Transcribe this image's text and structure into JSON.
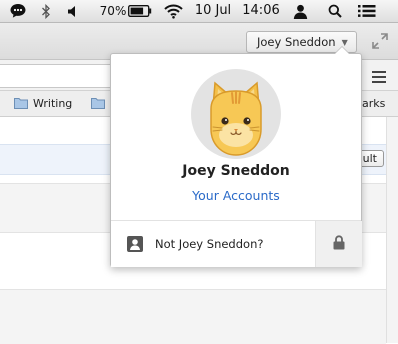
{
  "menubar": {
    "battery_percent": "70%",
    "date": "10 Jul",
    "time": "14:06",
    "icons": [
      "chat-bubble-icon",
      "bluetooth-icon",
      "volume-icon",
      "battery-icon",
      "wifi-icon",
      "user-icon",
      "search-icon",
      "list-icon"
    ]
  },
  "browser": {
    "profile_button_label": "Joey Sneddon",
    "bookmarks": [
      {
        "label": "Writing"
      },
      {
        "label": ""
      },
      {
        "label": "arks"
      }
    ],
    "partial_button_label": "ult"
  },
  "profile_popup": {
    "name": "Joey Sneddon",
    "accounts_link": "Your Accounts",
    "switch_label": "Not Joey Sneddon?",
    "link_color": "#2a6ac8"
  }
}
